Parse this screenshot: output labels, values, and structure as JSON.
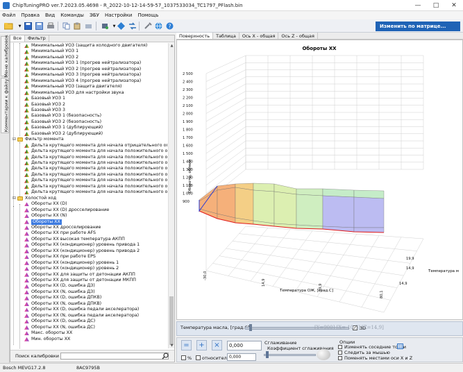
{
  "window": {
    "title": "ChipTuningPRO ver.7.2023.05.4698 - R_2022-10-12-14-59-57_1037533034_TC1797_PFlash.bin"
  },
  "menu": [
    "Файл",
    "Правка",
    "Вид",
    "Команды",
    "ЭБУ",
    "Настройки",
    "Помощь"
  ],
  "toolbar": {
    "change_label": "Изменить по матрице..."
  },
  "left_vtabs": {
    "tab1": "Меню калибровок",
    "tab2": "Комментарии к файлу"
  },
  "tree_tabs": [
    "Все",
    "Фильтр"
  ],
  "tree_items": [
    {
      "label": "Минимальный УОЗ (защита холодного двигателя)",
      "kind": "grid",
      "level": 2
    },
    {
      "label": "Минимальный УОЗ 1",
      "kind": "grid",
      "level": 2
    },
    {
      "label": "Минимальный УОЗ 2",
      "kind": "grid",
      "level": 2
    },
    {
      "label": "Минимальный УОЗ 1 (прогрев нейтрализатора)",
      "kind": "grid",
      "level": 2
    },
    {
      "label": "Минимальный УОЗ 2 (прогрев нейтрализатора)",
      "kind": "grid",
      "level": 2
    },
    {
      "label": "Минимальный УОЗ 3 (прогрев нейтрализатора)",
      "kind": "grid",
      "level": 2
    },
    {
      "label": "Минимальный УОЗ 4 (прогрев нейтрализатора)",
      "kind": "grid",
      "level": 2
    },
    {
      "label": "Минимальный УОЗ (защита двигателя)",
      "kind": "grid",
      "level": 2
    },
    {
      "label": "Минимальный УОЗ для настройки звука",
      "kind": "grid",
      "level": 2
    },
    {
      "label": "Базовый УОЗ 1",
      "kind": "grid",
      "level": 2
    },
    {
      "label": "Базовый УОЗ 2",
      "kind": "grid",
      "level": 2
    },
    {
      "label": "Базовый УОЗ 3",
      "kind": "grid",
      "level": 2
    },
    {
      "label": "Базовый УОЗ 1 (безопасность)",
      "kind": "grid",
      "level": 2
    },
    {
      "label": "Базовый УОЗ 2 (безопасность)",
      "kind": "grid",
      "level": 2
    },
    {
      "label": "Базовый УОЗ 1 (дублирующий)",
      "kind": "grid",
      "level": 2
    },
    {
      "label": "Базовый УОЗ 2 (дублирующий)",
      "kind": "grid",
      "level": 2
    },
    {
      "label": "Фильтр момента",
      "kind": "folder",
      "level": 1
    },
    {
      "label": "Дельта крутящего момента для начала отрицательного ограничения",
      "kind": "grid",
      "level": 2
    },
    {
      "label": "Дельта крутящего момента для начала положительного ограничения",
      "kind": "grid",
      "level": 2
    },
    {
      "label": "Дельта крутящего момента для начала положительного ограничения",
      "kind": "grid",
      "level": 2
    },
    {
      "label": "Дельта крутящего момента для начала положительного ограничения",
      "kind": "grid",
      "level": 2
    },
    {
      "label": "Дельта крутящего момента для начала положительного ограничения",
      "kind": "grid",
      "level": 2
    },
    {
      "label": "Дельта крутящего момента для начала положительного ограничения",
      "kind": "grid",
      "level": 2
    },
    {
      "label": "Дельта крутящего момента для начала положительного ограничения",
      "kind": "grid",
      "level": 2
    },
    {
      "label": "Дельта крутящего момента для начала положительного ограничения",
      "kind": "grid",
      "level": 2
    },
    {
      "label": "Дельта крутящего момента для начала положительного ограничения",
      "kind": "grid",
      "level": 2
    },
    {
      "label": "Холостой ход",
      "kind": "folder",
      "level": 1
    },
    {
      "label": "Обороты ХХ (D)",
      "kind": "pink",
      "level": 2
    },
    {
      "label": "Обороты ХХ (D) дросселирование",
      "kind": "pink",
      "level": 2
    },
    {
      "label": "Обороты ХХ (N)",
      "kind": "pink",
      "level": 2
    },
    {
      "label": "Обороты ХХ",
      "kind": "pink",
      "level": 2,
      "selected": true
    },
    {
      "label": "Обороты ХХ дросселирование",
      "kind": "pink",
      "level": 2
    },
    {
      "label": "Обороты ХХ при работе AFS",
      "kind": "pink",
      "level": 2
    },
    {
      "label": "Обороты ХХ высокая температура АКПП",
      "kind": "pink",
      "level": 2
    },
    {
      "label": "Обороты ХХ (кондиционер) уровень привода 1",
      "kind": "pink",
      "level": 2
    },
    {
      "label": "Обороты ХХ (кондиционер) уровень привода 2",
      "kind": "pink",
      "level": 2
    },
    {
      "label": "Обороты ХХ при работе EPS",
      "kind": "pink",
      "level": 2
    },
    {
      "label": "Обороты ХХ (кондиционер) уровень 1",
      "kind": "pink",
      "level": 2
    },
    {
      "label": "Обороты ХХ (кондиционер) уровень 2",
      "kind": "pink",
      "level": 2
    },
    {
      "label": "Обороты ХХ для защиты от детонации АКПП",
      "kind": "pink",
      "level": 2
    },
    {
      "label": "Обороты ХХ для защиты от детонации МКПП",
      "kind": "pink",
      "level": 2
    },
    {
      "label": "Обороты ХХ (D, ошибка ДЗ)",
      "kind": "pink",
      "level": 2
    },
    {
      "label": "Обороты ХХ (N, ошибка ДЗ)",
      "kind": "pink",
      "level": 2
    },
    {
      "label": "Обороты ХХ (D, ошибка ДПКВ)",
      "kind": "pink",
      "level": 2
    },
    {
      "label": "Обороты ХХ (N, ошибка ДПКВ)",
      "kind": "pink",
      "level": 2
    },
    {
      "label": "Обороты ХХ (D, ошибка педали акселератора)",
      "kind": "pink",
      "level": 2
    },
    {
      "label": "Обороты ХХ (N, ошибка педали акселератора)",
      "kind": "pink",
      "level": 2
    },
    {
      "label": "Обороты ХХ (D, ошибка ДС)",
      "kind": "pink",
      "level": 2
    },
    {
      "label": "Обороты ХХ (N, ошибка ДС)",
      "kind": "pink",
      "level": 2
    },
    {
      "label": "Макс. обороты ХХ",
      "kind": "pink",
      "level": 2
    },
    {
      "label": "Мин. обороты ХХ",
      "kind": "pink",
      "level": 2
    }
  ],
  "search": {
    "label": "Поиск калибровки",
    "value": ""
  },
  "view_tabs": [
    "Поверхность",
    "Таблица",
    "Ось X - общая",
    "Ось Z - общая"
  ],
  "plot": {
    "title": "Обороты ХХ",
    "y_label": "Обороты, об/мин",
    "y_ticks": [
      "2 500",
      "2 400",
      "2 300",
      "2 200",
      "2 100",
      "2 000",
      "1 900",
      "1 800",
      "1 700",
      "1 600",
      "1 500",
      "1 400",
      "1 300",
      "1 200",
      "1 100",
      "1 000",
      "900"
    ],
    "x_label": "Температура ОЖ, [град.С]",
    "x_ticks": [
      "-30,0",
      "14,9",
      "59,9",
      "80,1"
    ],
    "z_label": "Температура м",
    "z_ticks": [
      "19,9",
      "14,9",
      "14,9"
    ]
  },
  "temp_bar": {
    "label": "Температура масла, [град.С]",
    "checkbox_3d_label": "3D",
    "checkbox_3d_checked": true,
    "coords": "[Y=900] [X=-10,5] [Z=14,9]"
  },
  "controls": {
    "value1": "0,000",
    "value2": "0,000",
    "percent_label": "%",
    "relative_label": "относительно",
    "smoothing_label": "Сглаживание",
    "smoothing_coeff_label": "Коэффициент сглаживания",
    "options_label": "Опции",
    "opt1": "Изменять соседние точки",
    "opt2": "Следить за мышью",
    "opt3": "Поменять местами оси X и Z"
  },
  "status": {
    "ecu": "Bosch MEVG17.2.8",
    "checksum": "8AC9795B"
  },
  "chart_data": {
    "type": "surface",
    "title": "Обороты ХХ",
    "ylabel": "Обороты, об/мин",
    "xlabel": "Температура ОЖ, [град.С]",
    "zlabel": "Температура м",
    "ylim": [
      900,
      2500
    ],
    "x_ticks": [
      "-30,0",
      "14,9",
      "59,9",
      "80,1"
    ],
    "z_ticks": [
      "19,9",
      "14,9",
      "14,9"
    ],
    "note_values": "surface approximately 900–1100 rpm, higher at cold coolant"
  }
}
